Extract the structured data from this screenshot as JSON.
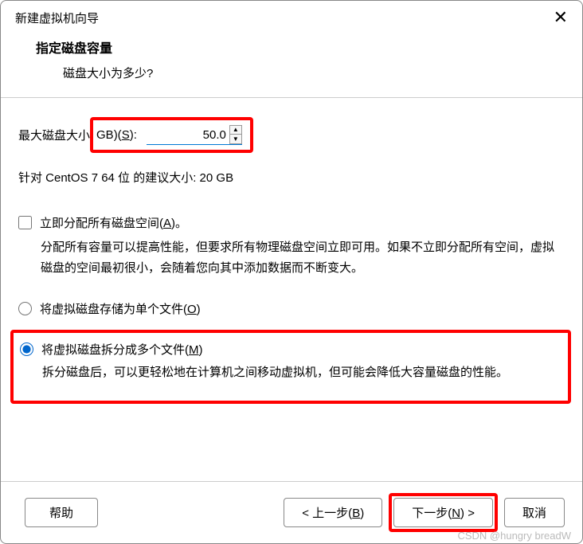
{
  "titlebar": {
    "title": "新建虚拟机向导",
    "close_symbol": "✕"
  },
  "header": {
    "heading": "指定磁盘容量",
    "subheading": "磁盘大小为多少?"
  },
  "disk_size": {
    "label": "最大磁盘大小 ",
    "unit_prefix": "GB)(",
    "unit_hotkey": "S",
    "unit_suffix": "):",
    "value": "50.0",
    "arrow_up": "▲",
    "arrow_down": "▼"
  },
  "recommended": "针对 CentOS 7 64 位 的建议大小: 20 GB",
  "allocate_now": {
    "label_prefix": "立即分配所有磁盘空间(",
    "hotkey": "A",
    "label_suffix": ")。",
    "checked": false,
    "description": "分配所有容量可以提高性能，但要求所有物理磁盘空间立即可用。如果不立即分配所有空间，虚拟磁盘的空间最初很小，会随着您向其中添加数据而不断变大。"
  },
  "store_single": {
    "label_prefix": "将虚拟磁盘存储为单个文件(",
    "hotkey": "O",
    "label_suffix": ")",
    "checked": false
  },
  "store_split": {
    "label_prefix": "将虚拟磁盘拆分成多个文件(",
    "hotkey": "M",
    "label_suffix": ")",
    "checked": true,
    "description": "拆分磁盘后，可以更轻松地在计算机之间移动虚拟机，但可能会降低大容量磁盘的性能。"
  },
  "footer": {
    "help": "帮助",
    "back_prefix": "< 上一步(",
    "back_hotkey": "B",
    "back_suffix": ")",
    "next_prefix": "下一步(",
    "next_hotkey": "N",
    "next_suffix": ") >",
    "cancel": "取消"
  },
  "watermark": "CSDN @hungry breadW"
}
